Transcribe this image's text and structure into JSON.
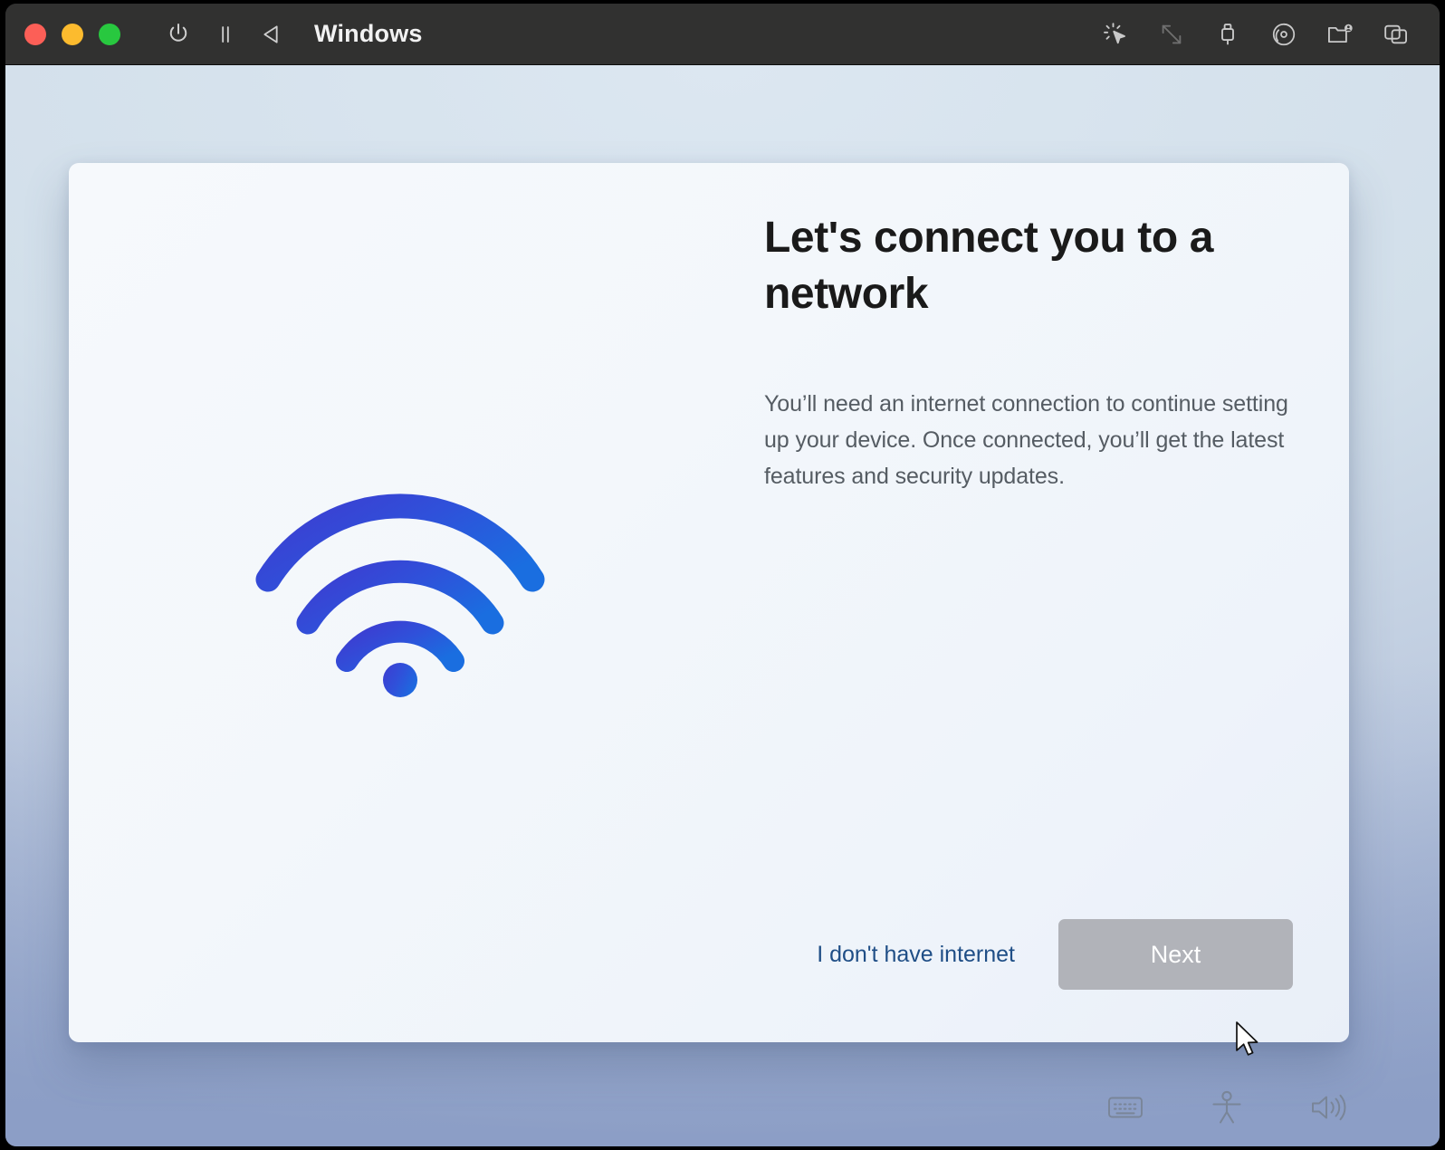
{
  "window": {
    "title": "Windows",
    "traffic_lights": [
      {
        "name": "close",
        "color": "#FC5F57"
      },
      {
        "name": "minimize",
        "color": "#FCBB2E"
      },
      {
        "name": "maximize",
        "color": "#28C83F"
      }
    ],
    "left_controls": [
      {
        "icon": "power-icon",
        "label": "Power"
      },
      {
        "icon": "pause-icon",
        "label": "Pause"
      },
      {
        "icon": "back-icon",
        "label": "Back"
      }
    ],
    "right_controls": [
      {
        "icon": "pointer-click-icon",
        "label": "Capture input"
      },
      {
        "icon": "resize-arrows-icon",
        "label": "Scale display"
      },
      {
        "icon": "usb-icon",
        "label": "USB devices"
      },
      {
        "icon": "optical-disc-icon",
        "label": "CD/DVD"
      },
      {
        "icon": "shared-folder-icon",
        "label": "Shared folders"
      },
      {
        "icon": "snapshots-icon",
        "label": "Snapshots"
      }
    ]
  },
  "oobe": {
    "heading": "Let's connect you to a network",
    "body": "You’ll need an internet connection to continue setting up your device. Once connected, you’ll get the latest features and security updates.",
    "link_label": "I don't have internet",
    "next_label": "Next",
    "wifi_icon_name": "wifi-icon",
    "tray": [
      {
        "icon": "on-screen-keyboard-icon",
        "label": "On-screen keyboard"
      },
      {
        "icon": "accessibility-icon",
        "label": "Accessibility"
      },
      {
        "icon": "volume-icon",
        "label": "Volume"
      }
    ]
  },
  "colors": {
    "titlebar_bg": "#313130",
    "desktop_bg_top": "#D5E1EC",
    "desktop_bg_bottom": "#97A7C8",
    "card_bg": "#F4F8FC",
    "heading_text": "#1A1A1A",
    "body_text": "#555C63",
    "link_text": "#1F4E86",
    "next_button_bg": "#B1B3B9",
    "next_button_text": "#FFFFFF",
    "wifi_gradient_start": "#3B41D2",
    "wifi_gradient_end": "#1A6EE0"
  }
}
